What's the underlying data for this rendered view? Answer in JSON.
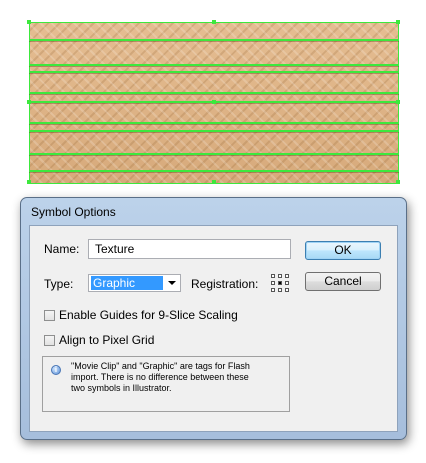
{
  "artwork": {
    "name": "wood-plank-texture",
    "selection_color": "#3de83d",
    "fill_color": "#dfb589"
  },
  "dialog": {
    "title": "Symbol Options",
    "name_label": "Name:",
    "name_value": "Texture",
    "type_label": "Type:",
    "type_value": "Graphic",
    "registration_label": "Registration:",
    "ok_label": "OK",
    "cancel_label": "Cancel",
    "enable_guides_label": "Enable Guides for 9-Slice Scaling",
    "align_pixel_label": "Align to Pixel Grid",
    "info_text": "\"Movie Clip\" and \"Graphic\" are tags for Flash import. There is no difference between these two symbols in Illustrator.",
    "info_icon": "info-icon"
  }
}
